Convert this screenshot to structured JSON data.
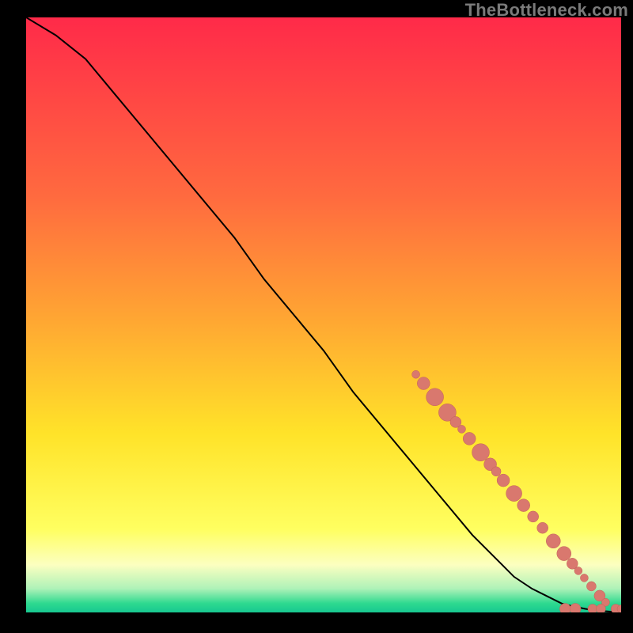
{
  "watermark": {
    "text": "TheBottleneck.com"
  },
  "colors": {
    "frame": "#000000",
    "watermark": "#7a7a7a",
    "line": "#000000",
    "dot_fill": "#d9786e",
    "dot_stroke": "#c26158",
    "gradient_stops": [
      {
        "pos": 0.0,
        "color": "#ff2a49"
      },
      {
        "pos": 0.3,
        "color": "#ff6a3f"
      },
      {
        "pos": 0.5,
        "color": "#ffa433"
      },
      {
        "pos": 0.7,
        "color": "#ffe329"
      },
      {
        "pos": 0.86,
        "color": "#ffff60"
      },
      {
        "pos": 0.92,
        "color": "#fcffc0"
      },
      {
        "pos": 0.96,
        "color": "#aef2b8"
      },
      {
        "pos": 0.985,
        "color": "#2dd98f"
      },
      {
        "pos": 1.0,
        "color": "#18c890"
      }
    ]
  },
  "chart_data": {
    "type": "line",
    "title": "",
    "xlabel": "",
    "ylabel": "",
    "xlim": [
      0,
      100
    ],
    "ylim": [
      0,
      100
    ],
    "series": [
      {
        "name": "curve",
        "style": "line",
        "x": [
          0,
          5,
          10,
          15,
          20,
          25,
          30,
          35,
          40,
          45,
          50,
          55,
          60,
          65,
          70,
          75,
          80,
          82,
          85,
          88,
          90,
          92,
          94,
          96,
          98,
          100
        ],
        "y": [
          100,
          97,
          93,
          87,
          81,
          75,
          69,
          63,
          56,
          50,
          44,
          37,
          31,
          25,
          19,
          13,
          8,
          6,
          4,
          2.5,
          1.5,
          1,
          0.6,
          0.3,
          0.15,
          0
        ]
      },
      {
        "name": "dots",
        "style": "scatter",
        "points": [
          {
            "x": 65.5,
            "y": 40.0,
            "r": 5
          },
          {
            "x": 66.8,
            "y": 38.5,
            "r": 8
          },
          {
            "x": 68.7,
            "y": 36.2,
            "r": 11
          },
          {
            "x": 70.8,
            "y": 33.6,
            "r": 11
          },
          {
            "x": 72.2,
            "y": 32.0,
            "r": 7
          },
          {
            "x": 73.2,
            "y": 30.8,
            "r": 5
          },
          {
            "x": 74.5,
            "y": 29.2,
            "r": 8
          },
          {
            "x": 76.4,
            "y": 26.9,
            "r": 11
          },
          {
            "x": 78.0,
            "y": 24.9,
            "r": 8
          },
          {
            "x": 79.0,
            "y": 23.7,
            "r": 6
          },
          {
            "x": 80.2,
            "y": 22.2,
            "r": 8
          },
          {
            "x": 82.0,
            "y": 20.0,
            "r": 10
          },
          {
            "x": 83.6,
            "y": 18.0,
            "r": 8
          },
          {
            "x": 85.2,
            "y": 16.1,
            "r": 7
          },
          {
            "x": 86.8,
            "y": 14.2,
            "r": 7
          },
          {
            "x": 88.6,
            "y": 12.0,
            "r": 9
          },
          {
            "x": 90.4,
            "y": 9.9,
            "r": 9
          },
          {
            "x": 91.8,
            "y": 8.2,
            "r": 7
          },
          {
            "x": 92.8,
            "y": 7.0,
            "r": 5
          },
          {
            "x": 93.8,
            "y": 5.8,
            "r": 5
          },
          {
            "x": 95.0,
            "y": 4.4,
            "r": 6
          },
          {
            "x": 96.4,
            "y": 2.8,
            "r": 7
          },
          {
            "x": 97.4,
            "y": 1.7,
            "r": 5
          },
          {
            "x": 90.6,
            "y": 0.6,
            "r": 7
          },
          {
            "x": 92.3,
            "y": 0.6,
            "r": 7
          },
          {
            "x": 95.2,
            "y": 0.6,
            "r": 6
          },
          {
            "x": 96.6,
            "y": 0.6,
            "r": 6
          },
          {
            "x": 99.1,
            "y": 0.6,
            "r": 6
          },
          {
            "x": 100.0,
            "y": 0.6,
            "r": 5
          }
        ]
      }
    ]
  }
}
